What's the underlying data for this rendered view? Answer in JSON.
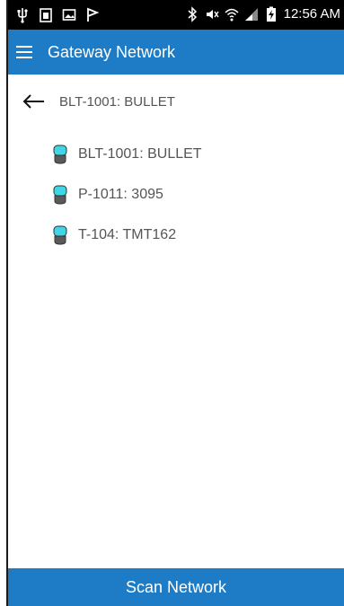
{
  "status_bar": {
    "time": "12:56 AM",
    "icons_left": [
      "usb-icon",
      "screenshot-icon",
      "image-icon",
      "flag-icon"
    ],
    "icons_right": [
      "bluetooth-icon",
      "mute-icon",
      "wifi-icon",
      "signal-icon",
      "battery-charging-icon"
    ]
  },
  "app_bar": {
    "title": "Gateway Network",
    "menu_icon": "hamburger-menu-icon",
    "color": "#1e7cc6"
  },
  "back_nav": {
    "label": "BLT-1001: BULLET",
    "icon": "back-arrow-icon"
  },
  "devices": [
    {
      "label": "BLT-1001: BULLET",
      "icon": "sensor-icon"
    },
    {
      "label": "P-1011: 3095",
      "icon": "sensor-icon"
    },
    {
      "label": "T-104: TMT162",
      "icon": "sensor-icon"
    }
  ],
  "scan_button": {
    "label": "Scan Network"
  },
  "colors": {
    "accent": "#1e7cc6",
    "sensor_cap": "#3fd6e6",
    "sensor_body": "#5a5a5a"
  }
}
